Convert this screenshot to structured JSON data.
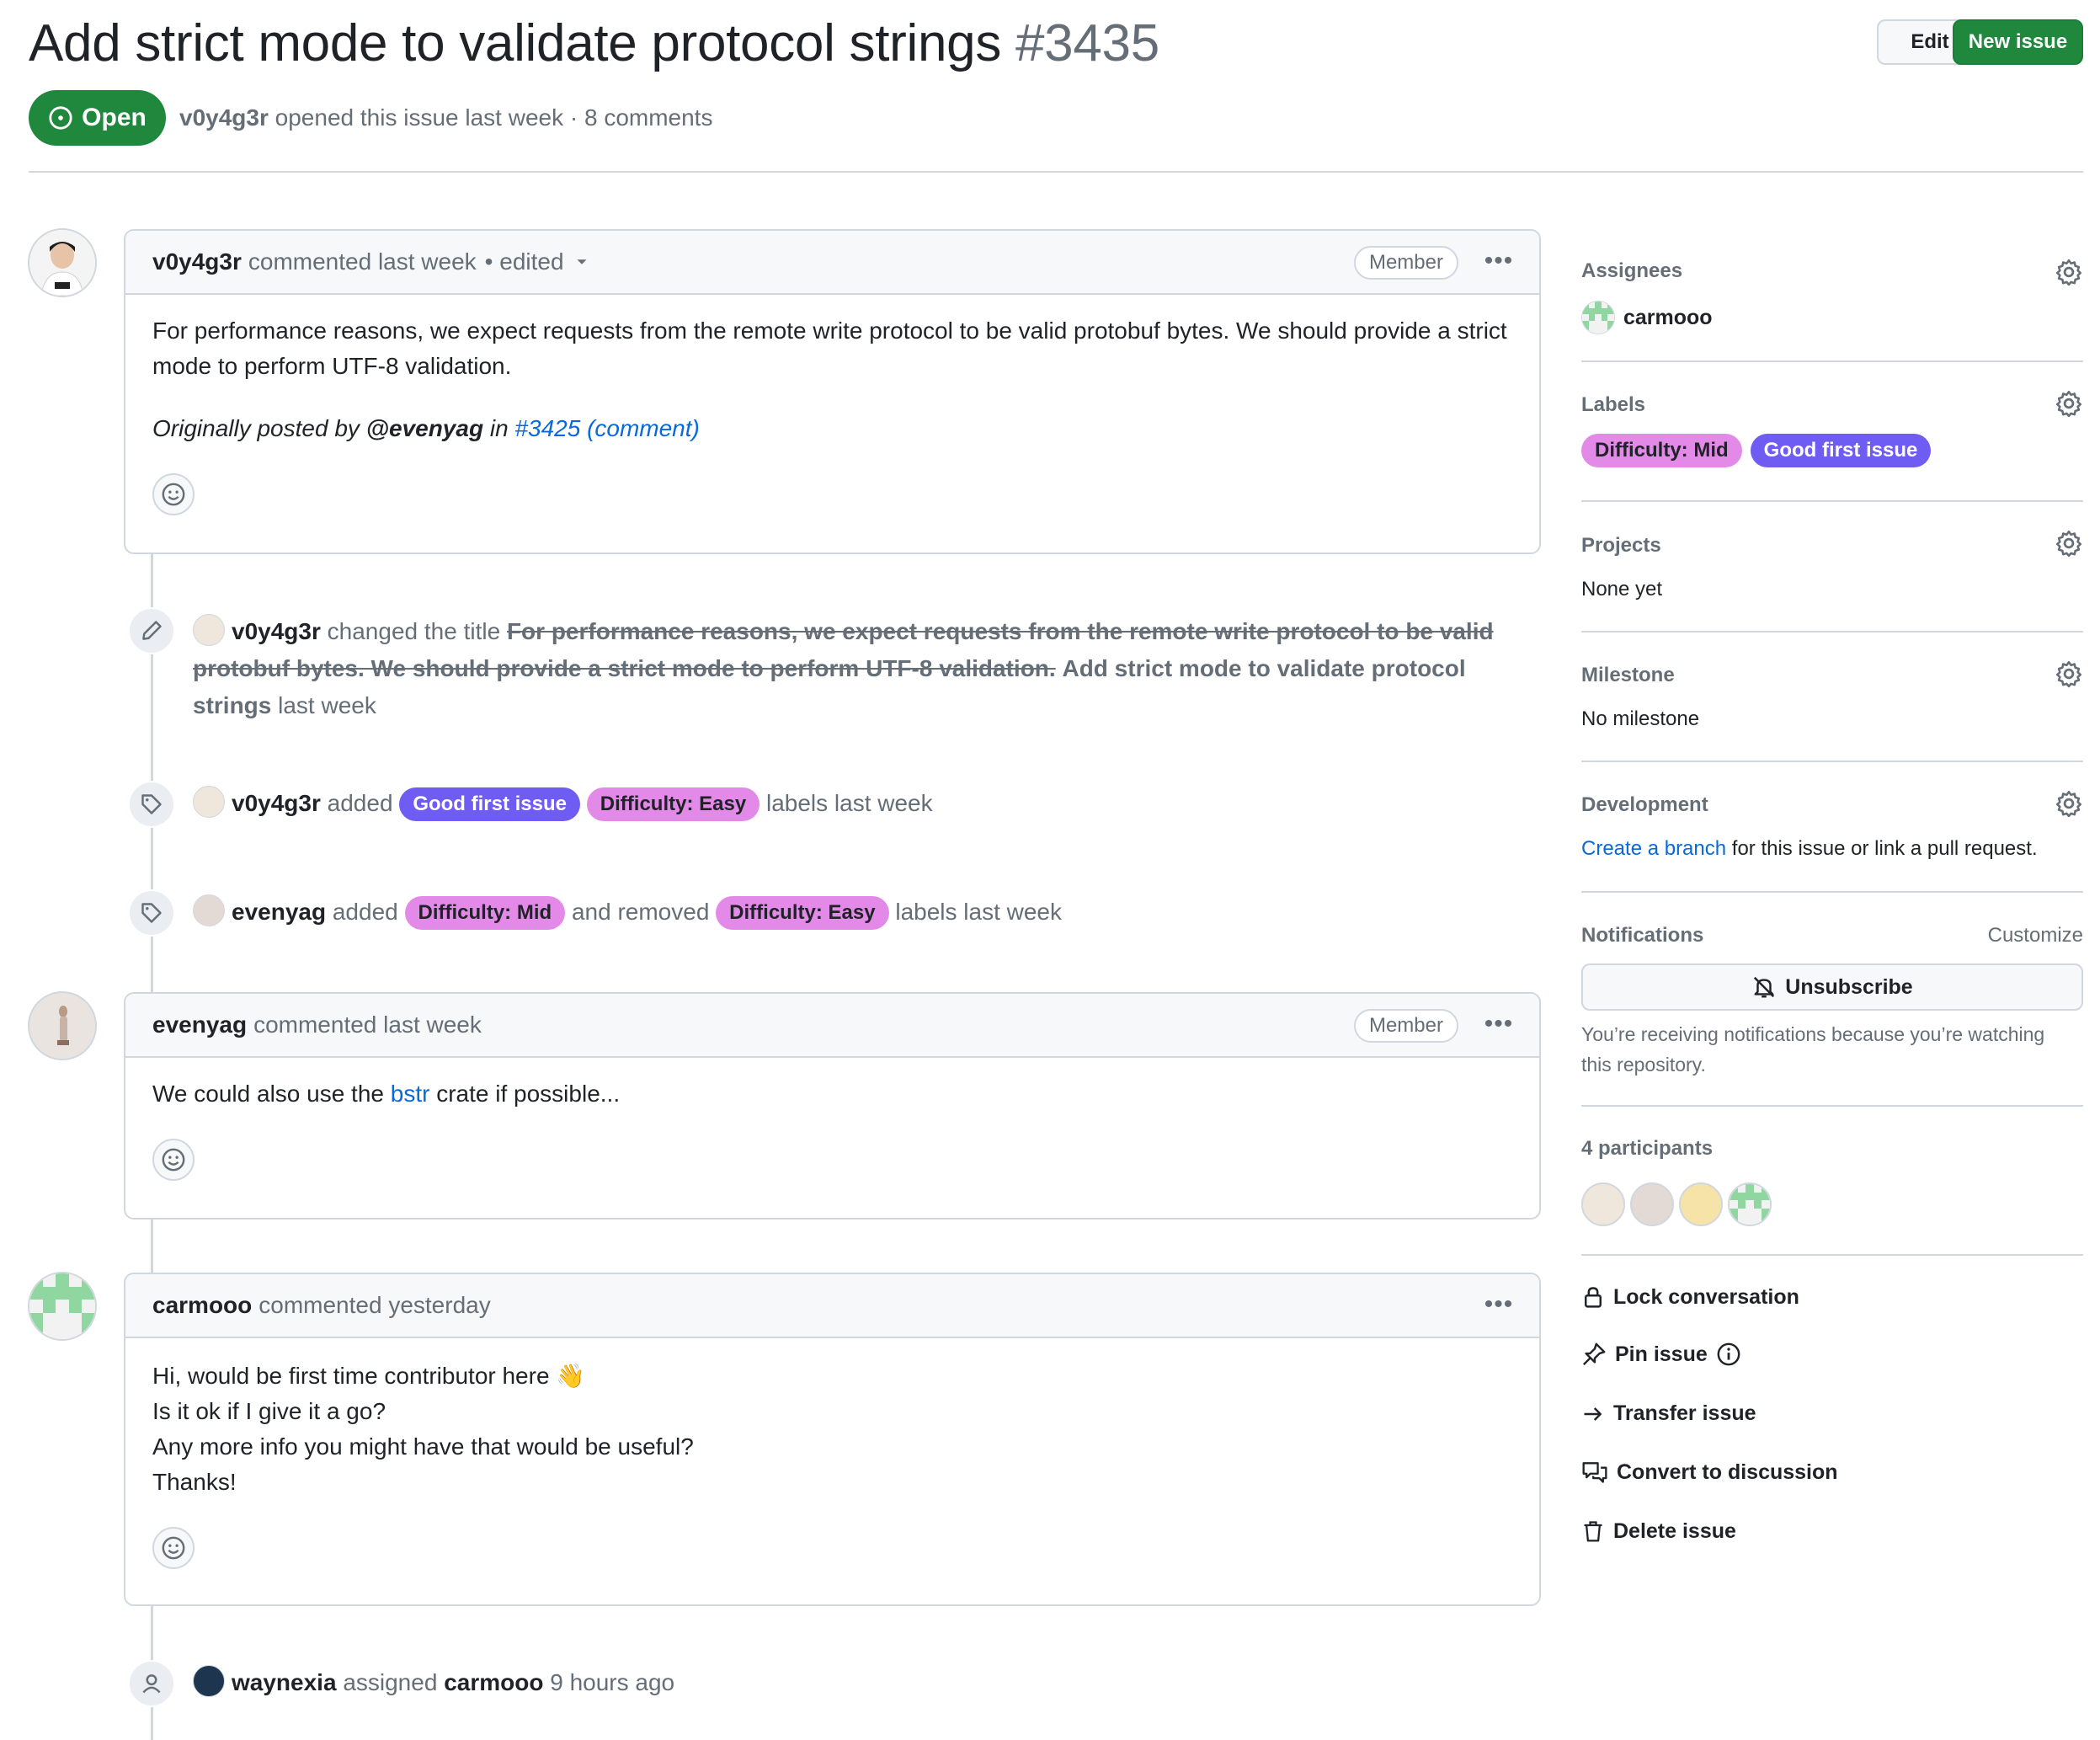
{
  "issue": {
    "title": "Add strict mode to validate protocol strings",
    "number": "#3435",
    "state": "Open",
    "author": "v0y4g3r",
    "meta_text": "opened this issue last week · 8 comments",
    "edit_label": "Edit",
    "new_issue_label": "New issue"
  },
  "comments": [
    {
      "author": "v0y4g3r",
      "header_text": "commented last week",
      "edited_text": "• edited",
      "role": "Member",
      "body_line": "For performance reasons, we expect requests from the remote write protocol to be valid protobuf bytes. We should provide a strict mode to perform UTF-8 validation.",
      "origin_prefix": "Originally posted by",
      "origin_user": "@evenyag",
      "origin_in": "in",
      "origin_link": "#3425 (comment)"
    },
    {
      "author": "evenyag",
      "header_text": "commented last week",
      "role": "Member",
      "body_pre": "We could also use the",
      "body_link": "bstr",
      "body_post": "crate if possible..."
    },
    {
      "author": "carmooo",
      "header_text": "commented yesterday",
      "lines": [
        "Hi, would be first time contributor here 👋",
        "Is it ok if I give it a go?",
        "Any more info you might have that would be useful?",
        "Thanks!"
      ]
    }
  ],
  "events": {
    "rename": {
      "actor": "v0y4g3r",
      "verb": "changed the title",
      "old_title": "For performance reasons, we expect requests from the remote write protocol to be valid protobuf bytes. We should provide a strict mode to perform UTF-8 validation.",
      "new_title": "Add strict mode to validate protocol strings",
      "when": "last week"
    },
    "labeled1": {
      "actor": "v0y4g3r",
      "verb": "added",
      "label_a": "Good first issue",
      "label_b": "Difficulty: Easy",
      "tail": "labels last week"
    },
    "labeled2": {
      "actor": "evenyag",
      "verb": "added",
      "label_a": "Difficulty: Mid",
      "mid": "and removed",
      "label_b": "Difficulty: Easy",
      "tail": "labels last week"
    },
    "assigned": {
      "actor": "waynexia",
      "verb": "assigned",
      "target": "carmooo",
      "when": "9 hours ago"
    }
  },
  "sidebar": {
    "assignees": {
      "heading": "Assignees",
      "user": "carmooo"
    },
    "labels": {
      "heading": "Labels",
      "items": [
        "Difficulty: Mid",
        "Good first issue"
      ]
    },
    "projects": {
      "heading": "Projects",
      "value": "None yet"
    },
    "milestone": {
      "heading": "Milestone",
      "value": "No milestone"
    },
    "development": {
      "heading": "Development",
      "link": "Create a branch",
      "text": "for this issue or link a pull request."
    },
    "notifications": {
      "heading": "Notifications",
      "customize": "Customize",
      "button": "Unsubscribe",
      "reason": "You’re receiving notifications because you’re watching this repository."
    },
    "participants": {
      "heading": "4 participants"
    },
    "actions": {
      "lock": "Lock conversation",
      "pin": "Pin issue",
      "transfer": "Transfer issue",
      "convert": "Convert to discussion",
      "delete": "Delete issue"
    }
  },
  "colors": {
    "open_green": "#1f883d",
    "label_purple": "#6f5cf2",
    "label_pink": "#e38ae8",
    "link_blue": "#0969da"
  }
}
